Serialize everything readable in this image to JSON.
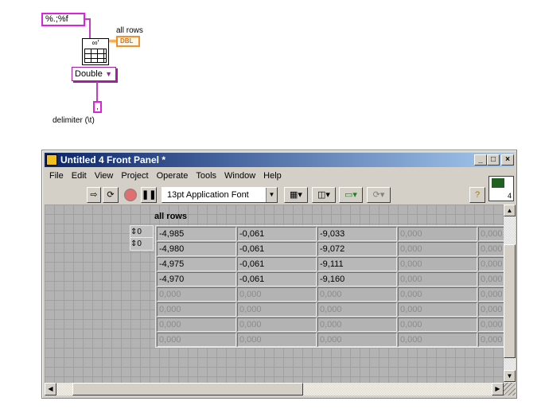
{
  "diagram": {
    "format_constant": "%.;%f",
    "output_label": "all rows",
    "output_type": "DBL",
    "type_selector": "Double",
    "delimiter_value": ",",
    "delimiter_label": "delimiter (\\t)"
  },
  "window": {
    "title": "Untitled 4 Front Panel *",
    "menu": [
      "File",
      "Edit",
      "View",
      "Project",
      "Operate",
      "Tools",
      "Window",
      "Help"
    ],
    "font_selector": "13pt Application Font",
    "connector_number": "4",
    "help_label": "?"
  },
  "array": {
    "label": "all rows",
    "index_row": "0",
    "index_col": "0",
    "rows": [
      [
        "-4,985",
        "-0,061",
        "-9,033",
        "0,000",
        "0,000"
      ],
      [
        "-4,980",
        "-0,061",
        "-9,072",
        "0,000",
        "0,000"
      ],
      [
        "-4,975",
        "-0,061",
        "-9,111",
        "0,000",
        "0,000"
      ],
      [
        "-4,970",
        "-0,061",
        "-9,160",
        "0,000",
        "0,000"
      ],
      [
        "0,000",
        "0,000",
        "0,000",
        "0,000",
        "0,000"
      ],
      [
        "0,000",
        "0,000",
        "0,000",
        "0,000",
        "0,000"
      ],
      [
        "0,000",
        "0,000",
        "0,000",
        "0,000",
        "0,000"
      ],
      [
        "0,000",
        "0,000",
        "0,000",
        "0,000",
        "0,000"
      ]
    ]
  }
}
